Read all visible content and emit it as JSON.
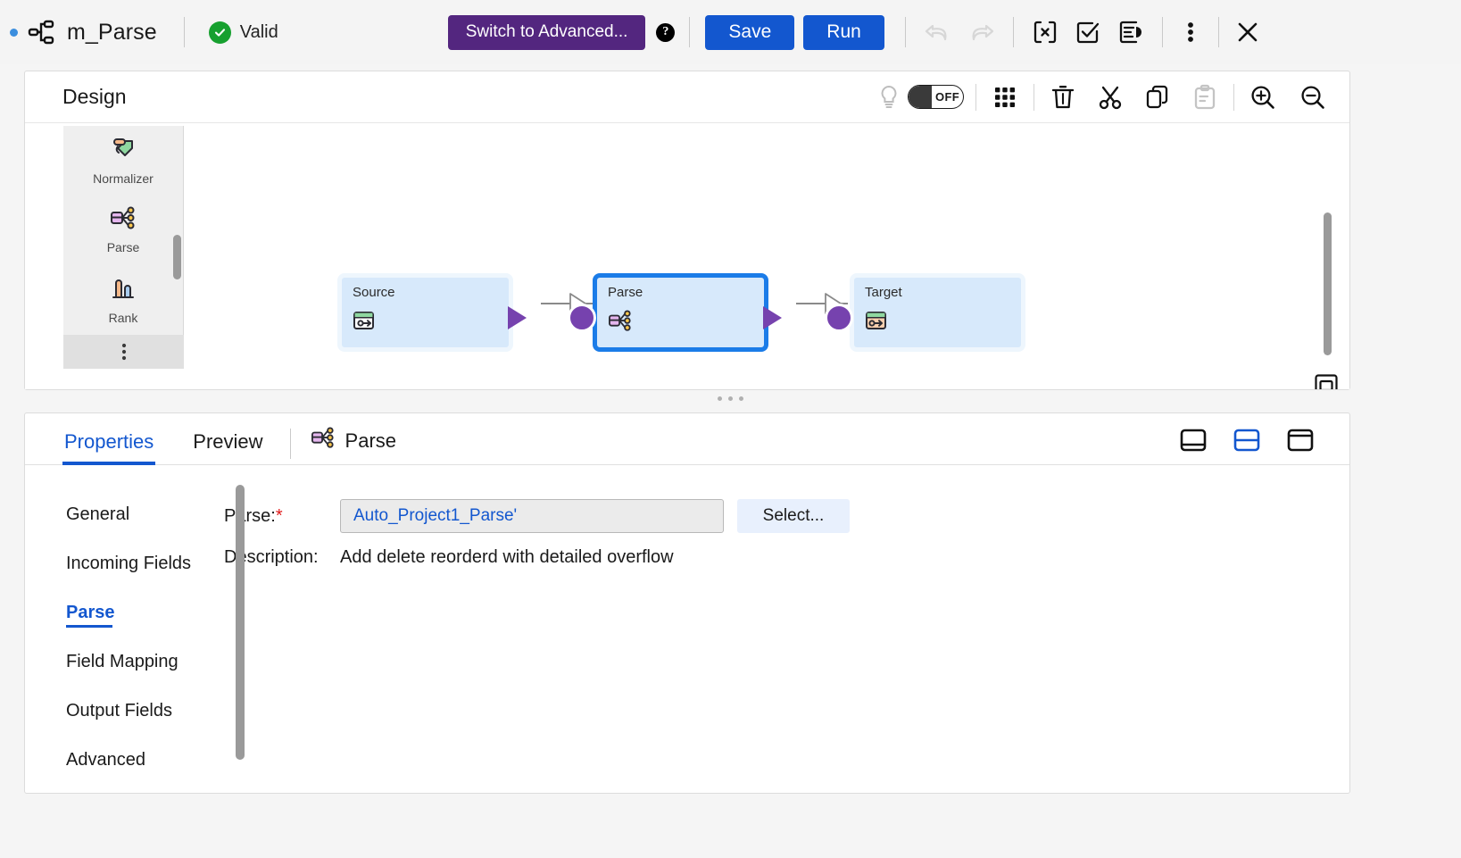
{
  "topbar": {
    "app_title": "m_Parse",
    "status_text": "Valid",
    "status_color": "#17a02f",
    "advanced_button": "Switch to Advanced...",
    "advanced_color": "#53267f",
    "help_glyph": "?",
    "save_button": "Save",
    "run_button": "Run",
    "primary_color": "#1357cf",
    "icons": {
      "mapping": "mapping-icon",
      "undo": "undo-icon",
      "redo": "redo-icon",
      "parameters": "parameters-icon",
      "validate": "validate-icon",
      "notes": "notes-icon",
      "more": "more-vertical-icon",
      "close": "close-icon"
    }
  },
  "design": {
    "label": "Design",
    "toggle": {
      "name": "highlight-toggle",
      "state": "OFF"
    },
    "tools": [
      "lightbulb-icon",
      "grid-icon",
      "delete-icon",
      "cut-icon",
      "copy-icon",
      "paste-icon",
      "zoom-in-icon",
      "zoom-out-icon"
    ],
    "palette": {
      "items": [
        {
          "label": "Normalizer",
          "icon": "normalizer-icon"
        },
        {
          "label": "Parse",
          "icon": "parse-icon"
        },
        {
          "label": "Rank",
          "icon": "rank-icon"
        }
      ],
      "more": "more-vertical-icon"
    },
    "nodes": [
      {
        "title": "Source",
        "icon": "source-icon",
        "selected": false
      },
      {
        "title": "Parse",
        "icon": "parse-icon",
        "selected": true
      },
      {
        "title": "Target",
        "icon": "target-icon",
        "selected": false
      }
    ],
    "fit_button": "fit-to-window-icon"
  },
  "properties": {
    "tabs": [
      {
        "label": "Properties",
        "active": true
      },
      {
        "label": "Preview",
        "active": false
      }
    ],
    "node_tab": {
      "label": "Parse",
      "icon": "parse-icon"
    },
    "layout_buttons": [
      {
        "name": "layout-bottom-panel",
        "active": false
      },
      {
        "name": "layout-split-panel",
        "active": true
      },
      {
        "name": "layout-top-panel",
        "active": false
      }
    ],
    "nav": [
      {
        "label": "General",
        "active": false
      },
      {
        "label": "Incoming Fields",
        "active": false
      },
      {
        "label": "Parse",
        "active": true
      },
      {
        "label": "Field Mapping",
        "active": false
      },
      {
        "label": "Output Fields",
        "active": false
      },
      {
        "label": "Advanced",
        "active": false
      }
    ],
    "form": {
      "parse_label": "Parse:",
      "parse_required": "*",
      "parse_value": "Auto_Project1_Parse'",
      "select_button": "Select...",
      "description_label": "Description:",
      "description_value": "Add delete reorderd with detailed overflow"
    }
  }
}
